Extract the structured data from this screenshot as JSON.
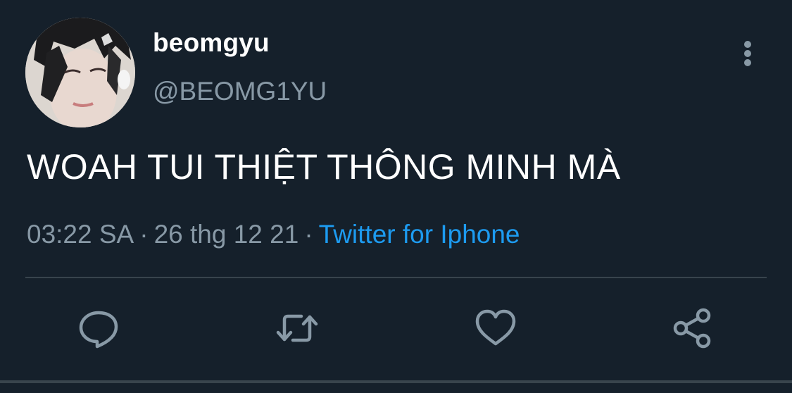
{
  "tweet": {
    "author": {
      "display_name": "beomgyu",
      "handle": "@BEOMG1YU"
    },
    "text": "WOAH TUI THIỆT THÔNG MINH MÀ",
    "meta": {
      "time": "03:22 SA",
      "date": "26 thg 12 21",
      "source": "Twitter for Iphone"
    }
  },
  "icons": {
    "more": "more-vertical-icon",
    "reply": "reply-icon",
    "retweet": "retweet-icon",
    "like": "heart-icon",
    "share": "share-icon"
  },
  "colors": {
    "background": "#15202b",
    "secondary_text": "#8899a6",
    "link": "#1d9bf0",
    "divider": "#38444d"
  }
}
